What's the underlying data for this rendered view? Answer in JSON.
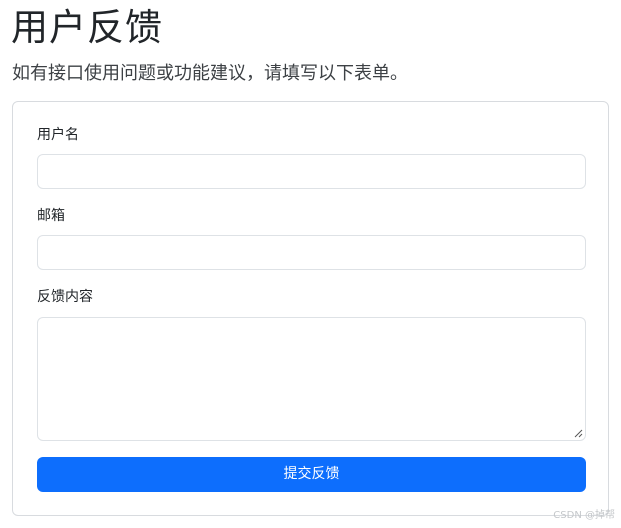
{
  "page": {
    "title": "用户反馈",
    "subtitle": "如有接口使用问题或功能建议，请填写以下表单。"
  },
  "form": {
    "username": {
      "label": "用户名",
      "value": ""
    },
    "email": {
      "label": "邮箱",
      "value": ""
    },
    "feedback": {
      "label": "反馈内容",
      "value": ""
    },
    "submit_label": "提交反馈"
  },
  "watermark": "CSDN @掉帮",
  "colors": {
    "primary": "#0d6efd",
    "border": "#dee2e6",
    "text": "#212529"
  }
}
